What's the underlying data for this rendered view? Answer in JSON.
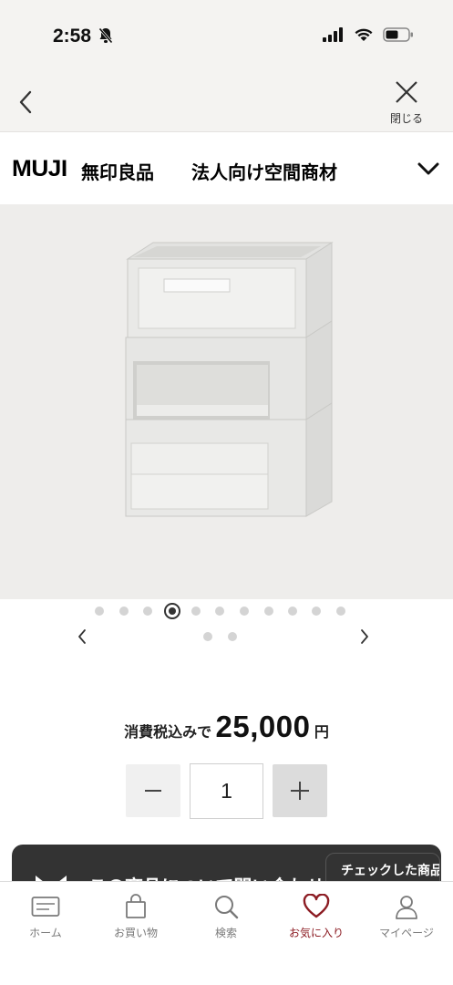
{
  "status_bar": {
    "time": "2:58"
  },
  "nav": {
    "close_label": "閉じる"
  },
  "brand": {
    "logo": "MUJI",
    "kanji": "無印良品",
    "subtitle": "法人向け空間商材"
  },
  "carousel": {
    "total_dots": 12,
    "active_index": 3,
    "extra_dots": 2
  },
  "price": {
    "label": "消費税込みで",
    "value": "25,000",
    "unit": "円"
  },
  "quantity": {
    "value": "1"
  },
  "contact": {
    "label": "この商品について問い合わせる",
    "badge": "チェックした商品を見る"
  },
  "colors": {
    "accent": "#8c1c23",
    "dark": "#333333",
    "background": "#f4f3f1"
  },
  "tabs": [
    {
      "label": "ホーム",
      "icon": "card-icon"
    },
    {
      "label": "お買い物",
      "icon": "shopping-bag-icon"
    },
    {
      "label": "検索",
      "icon": "search-icon"
    },
    {
      "label": "お気に入り",
      "icon": "heart-icon",
      "active": true
    },
    {
      "label": "マイページ",
      "icon": "person-icon"
    }
  ]
}
